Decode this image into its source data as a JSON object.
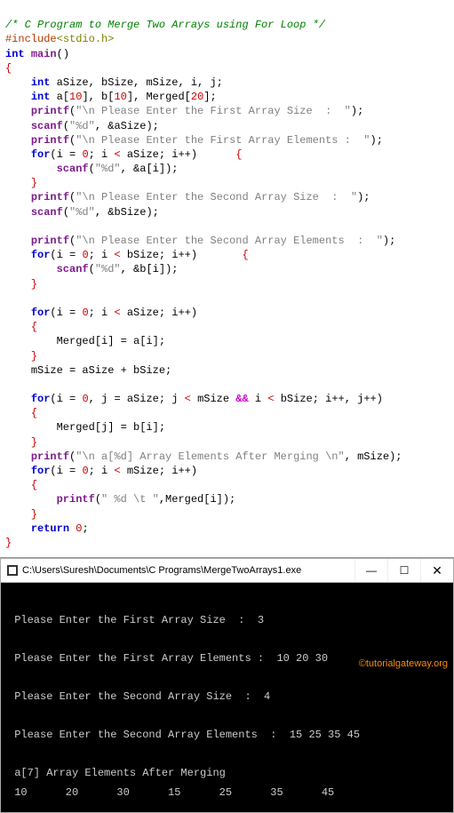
{
  "code": {
    "comment": "/* C Program to Merge Two Arrays using For Loop */",
    "include": "#include",
    "include_header_open": "<",
    "include_header": "stdio.h",
    "include_header_close": ">",
    "int": "int",
    "main": "main",
    "paren_open": "(",
    "paren_close": ")",
    "brace_open": "{",
    "brace_close": "}",
    "decl1_vars": " aSize, bSize, mSize, i, j;",
    "decl2_a": " a",
    "decl2_open": "[",
    "decl2_10a": "10",
    "decl2_close": "]",
    "decl2_b": ", b",
    "decl2_10b": "10",
    "decl2_m": ", Merged",
    "decl2_20": "20",
    "semi": ";",
    "printf": "printf",
    "scanf": "scanf",
    "for": "for",
    "return": "return",
    "zero": "0",
    "str_first_size": "\"\\n Please Enter the First Array Size  :  \"",
    "str_pd": "\"%d\"",
    "amp_a": " &aSize",
    "str_first_elem": "\"\\n Please Enter the First Array Elements :  \"",
    "loop1_init": "i = ",
    "loop1_cond": "; i ",
    "loop1_lt": "<",
    "loop_aSize": " aSize; i++",
    "loop_brace_open": "{",
    "scanf_ai": " &a[i]",
    "str_second_size": "\"\\n Please Enter the Second Array Size  :  \"",
    "amp_b": " &bSize",
    "str_second_elem": "\"\\n Please Enter the Second Array Elements  :  \"",
    "loop_bSize": " bSize; i++",
    "scanf_bi": " &b[i]",
    "merged_ai": "Merged[i] = a[i];",
    "msize_assign": "mSize = aSize + bSize;",
    "loop3_init": "i = ",
    "loop3_j": ", j = aSize; j ",
    "loop3_msize": " mSize ",
    "and": "&&",
    "loop3_i_lt": " i ",
    "loop3_bsize": " bSize; i++, j++",
    "merged_jb": "Merged[j] = b[i];",
    "str_after": "\"\\n a[%d] Array Elements After Merging \\n\"",
    "msize_arg": ", mSize",
    "loop4_msize": " mSize; i++",
    "printf_merged": "\" %d \\t \"",
    "merged_i": ",Merged[i]"
  },
  "console": {
    "title": "C:\\Users\\Suresh\\Documents\\C Programs\\MergeTwoArrays1.exe",
    "line1": " Please Enter the First Array Size  :  3",
    "line2": " Please Enter the First Array Elements :  10 20 30",
    "line3": " Please Enter the Second Array Size  :  4",
    "line4": " Please Enter the Second Array Elements  :  15 25 35 45",
    "line5": " a[7] Array Elements After Merging",
    "line6": " 10      20      30      15      25      35      45",
    "minimize": "—",
    "maximize": "☐",
    "close": "✕"
  },
  "watermark": "©tutorialgateway.org"
}
